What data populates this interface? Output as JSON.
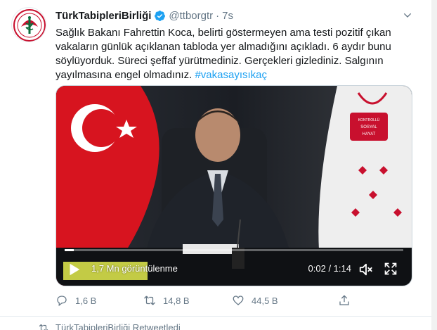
{
  "tweet": {
    "display_name": "TürkTabipleriBirliği",
    "handle": "@ttborgtr",
    "separator": "·",
    "time": "7s",
    "text": "Sağlık Bakanı Fahrettin Koca, belirti göstermeyen ama testi pozitif çıkan vakaların günlük açıklanan tabloda yer almadığını açıkladı. 6 aydır bunu söylüyorduk.  Süreci şeffaf yürütmediniz. Gerçekleri gizlediniz. Salgının yayılmasına engel olmadınız.",
    "hashtag": "#vakasayısıkaç"
  },
  "video": {
    "views": "1,7 Mn görüntülenme",
    "time_readout": "0:02 / 1:14",
    "progress": 0.027,
    "sign_text": "KONTROLLÜ SOSYAL HAYAT"
  },
  "actions": {
    "reply_count": "1,6 B",
    "retweet_count": "14,8 B",
    "like_count": "44,5 B"
  },
  "next_item": {
    "text": "TürkTabipleriBirliği Retweetledi"
  },
  "colors": {
    "accent": "#1da1f2",
    "muted": "#657786",
    "flag_red": "#e30a17"
  },
  "icons": [
    "verified-badge-icon",
    "chevron-down-icon",
    "play-icon",
    "mute-icon",
    "fullscreen-icon",
    "reply-icon",
    "retweet-icon",
    "like-icon",
    "share-icon",
    "retweet-small-icon"
  ]
}
